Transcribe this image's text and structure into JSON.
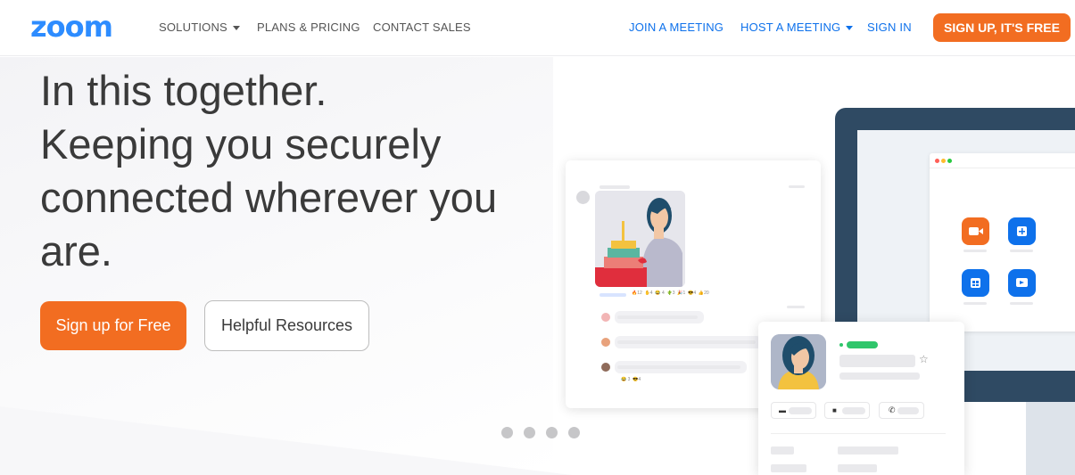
{
  "nav": {
    "logo": "zoom",
    "solutions": "SOLUTIONS",
    "plans": "PLANS & PRICING",
    "contact": "CONTACT SALES",
    "join": "JOIN A MEETING",
    "host": "HOST A MEETING",
    "signin": "SIGN IN",
    "signup": "SIGN UP, IT'S FREE"
  },
  "hero": {
    "lines": [
      "In this together.",
      "Keeping you securely",
      "connected wherever you",
      "are."
    ],
    "primary_button": "Sign up for Free",
    "secondary_button": "Helpful Resources"
  },
  "carousel": {
    "slides": 4,
    "active": 0
  },
  "colors": {
    "accent_orange": "#f26d21",
    "brand_blue": "#2d8cff",
    "link_blue": "#0e71eb",
    "monitor_navy": "#2f4a63"
  },
  "icons": [
    "caret-down-icon",
    "video-icon",
    "plus-icon",
    "calendar-icon",
    "share-screen-icon",
    "star-icon",
    "chat-icon",
    "phone-icon"
  ]
}
